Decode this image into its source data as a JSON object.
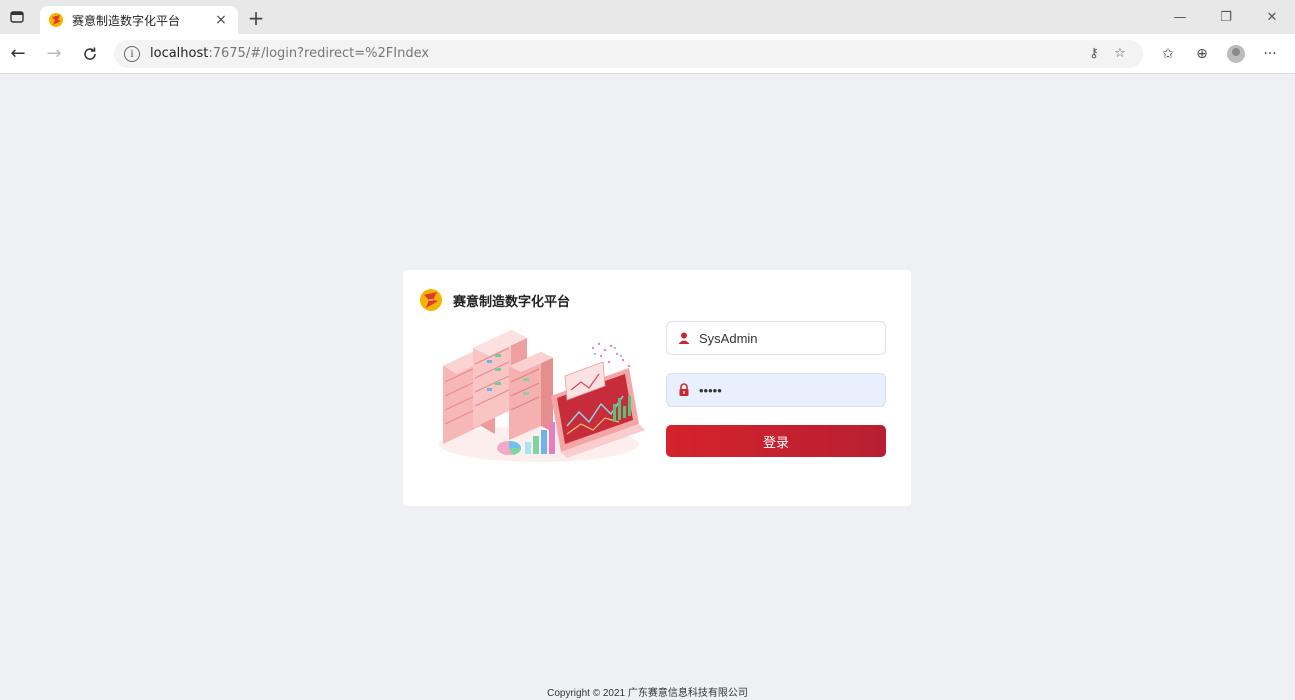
{
  "browser": {
    "tab_title": "赛意制造数字化平台",
    "tab_close": "×",
    "new_tab": "+",
    "url_host": "localhost",
    "url_rest": ":7675/#/login?redirect=%2FIndex"
  },
  "brand": {
    "name": "赛意制造数字化平台",
    "colors": {
      "accent": "#d4232c",
      "logo_yellow": "#f5b400",
      "logo_red": "#e03a2c"
    }
  },
  "login": {
    "username": "SysAdmin",
    "password_masked": "•••••",
    "submit_label": "登录"
  },
  "footer": {
    "copyright": "Copyright © 2021 广东赛意信息科技有限公司"
  }
}
